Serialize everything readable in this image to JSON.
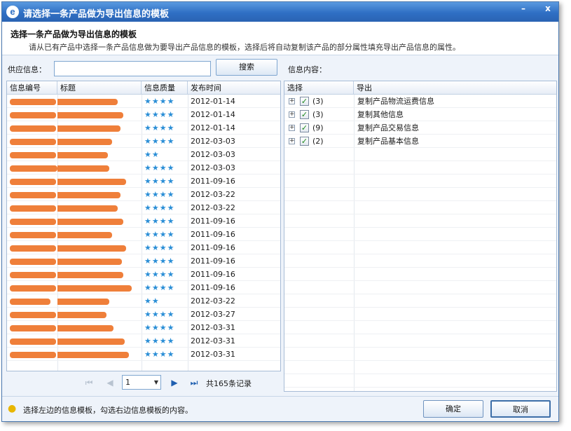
{
  "window": {
    "title": "请选择一条产品做为导出信息的模板",
    "logo": "e",
    "minimize": "–",
    "close": "x"
  },
  "header": {
    "title": "选择一条产品做为导出信息的模板",
    "description": "请从已有产品中选择一条产品信息做为要导出产品信息的模板，选择后将自动复制该产品的部分属性填充导出产品信息的属性。"
  },
  "search": {
    "label": "供应信息：",
    "value": "",
    "button": "搜索"
  },
  "right_label": "信息内容：",
  "left_grid": {
    "columns": [
      "信息编号",
      "标题",
      "信息质量",
      "发布时间"
    ],
    "rows": [
      {
        "stars": "★★★★",
        "date": "2012-01-14"
      },
      {
        "stars": "★★★★",
        "date": "2012-01-14"
      },
      {
        "stars": "★★★★",
        "date": "2012-01-14"
      },
      {
        "stars": "★★★★",
        "date": "2012-03-03"
      },
      {
        "stars": "★★",
        "date": "2012-03-03"
      },
      {
        "stars": "★★★★",
        "date": "2012-03-03"
      },
      {
        "stars": "★★★★",
        "date": "2011-09-16"
      },
      {
        "stars": "★★★★",
        "date": "2012-03-22"
      },
      {
        "stars": "★★★★",
        "date": "2012-03-22"
      },
      {
        "stars": "★★★★",
        "date": "2011-09-16"
      },
      {
        "stars": "★★★★",
        "date": "2011-09-16"
      },
      {
        "stars": "★★★★",
        "date": "2011-09-16"
      },
      {
        "stars": "★★★★",
        "date": "2011-09-16"
      },
      {
        "stars": "★★★★",
        "date": "2011-09-16"
      },
      {
        "stars": "★★★★",
        "date": "2011-09-16"
      },
      {
        "stars": "★★",
        "date": "2012-03-22"
      },
      {
        "stars": "★★★★",
        "date": "2012-03-27"
      },
      {
        "stars": "★★★★",
        "date": "2012-03-31"
      },
      {
        "stars": "★★★★",
        "date": "2012-03-31"
      },
      {
        "stars": "★★★★",
        "date": "2012-03-31"
      }
    ]
  },
  "right_grid": {
    "columns": [
      "选择",
      "导出"
    ],
    "rows": [
      {
        "count": "(3)",
        "name": "复制产品物流运费信息",
        "checked": "✓"
      },
      {
        "count": "(3)",
        "name": "复制其他信息",
        "checked": "✓"
      },
      {
        "count": "(9)",
        "name": "复制产品交易信息",
        "checked": "✓"
      },
      {
        "count": "(2)",
        "name": "复制产品基本信息",
        "checked": "✓"
      }
    ],
    "expander": "+"
  },
  "pager": {
    "first": "⏮",
    "prev": "◀",
    "page": "1",
    "next": "▶",
    "last": "⏭",
    "total": "共165条记录"
  },
  "status": {
    "hint": "选择左边的信息模板，勾选右边信息模板的内容。",
    "hint_icon": "lightbulb-icon",
    "ok": "确定",
    "cancel": "取消"
  }
}
